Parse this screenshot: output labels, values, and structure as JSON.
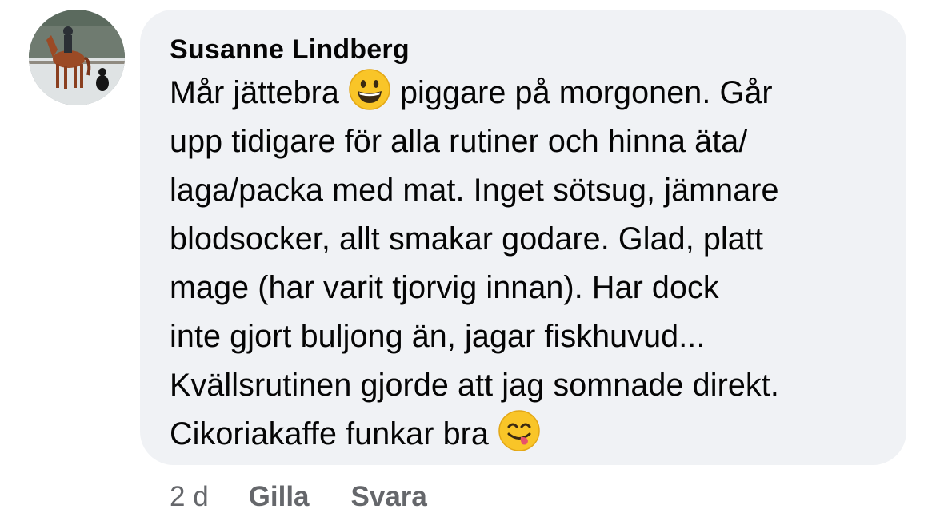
{
  "comment": {
    "author": "Susanne Lindberg",
    "avatar_icon": "profile-photo-horse-rider",
    "lines": {
      "l1_before": "Mår jättebra",
      "l1_emoji": "grinning-face-emoji",
      "l1_after": "piggare på morgonen. Går",
      "l2": "upp tidigare för alla rutiner och hinna äta/",
      "l3": "laga/packa med mat. Inget sötsug, jämnare",
      "l4": "blodsocker, allt smakar godare. Glad, platt",
      "l5": "mage (har varit tjorvig innan). Har dock",
      "l6": "inte gjort buljong än, jagar fiskhuvud...",
      "l7": "Kvällsrutinen gjorde att jag somnade direkt.",
      "l8": "Cikoriakaffe funkar bra",
      "l8_emoji": "face-savoring-food-emoji"
    }
  },
  "actions": {
    "time": "2 d",
    "like": "Gilla",
    "reply": "Svara"
  },
  "colors": {
    "bubble": "#f0f2f5",
    "text": "#050505",
    "muted": "#65676b"
  }
}
